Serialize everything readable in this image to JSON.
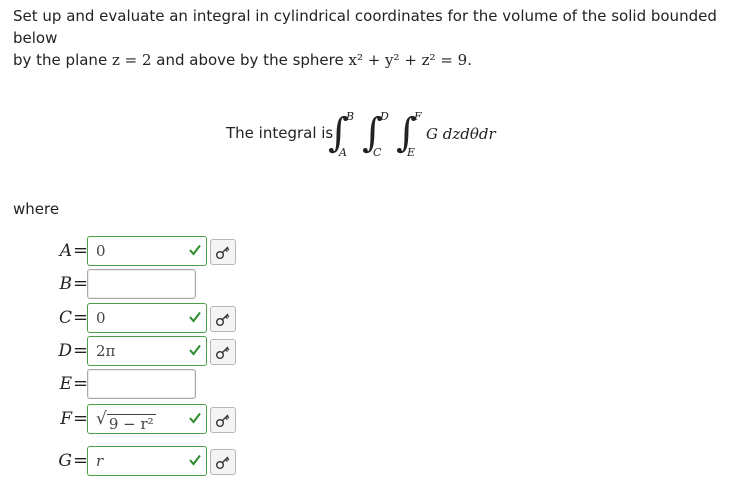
{
  "prompt": {
    "line1": "Set up and evaluate an integral in cylindrical coordinates for the volume of the solid bounded below",
    "line2_prefix": "by the plane ",
    "plane_eq": "z = 2",
    "line2_mid": " and above by the sphere ",
    "sphere_eq": "x² + y² + z² = 9",
    "line2_suffix": "."
  },
  "integral": {
    "label": "The integral is",
    "upper": [
      "B",
      "D",
      "F"
    ],
    "lower": [
      "A",
      "C",
      "E"
    ],
    "integrand": "G dzdθdr"
  },
  "where_label": "where",
  "answers": [
    {
      "var": "A",
      "value": "0",
      "correct": true
    },
    {
      "var": "B",
      "value": "",
      "correct": false
    },
    {
      "var": "C",
      "value": "0",
      "correct": true
    },
    {
      "var": "D",
      "value": "2π",
      "correct": true
    },
    {
      "var": "E",
      "value": "",
      "correct": false
    },
    {
      "var": "F",
      "value": "9 − r²",
      "correct": true,
      "sqrt": true
    },
    {
      "var": "G",
      "value": "r",
      "correct": true
    }
  ],
  "colors": {
    "correct_border": "#4aa04a",
    "check": "#2e8b2e"
  },
  "icons": {
    "check": "checkmark-icon",
    "key": "key-icon"
  }
}
